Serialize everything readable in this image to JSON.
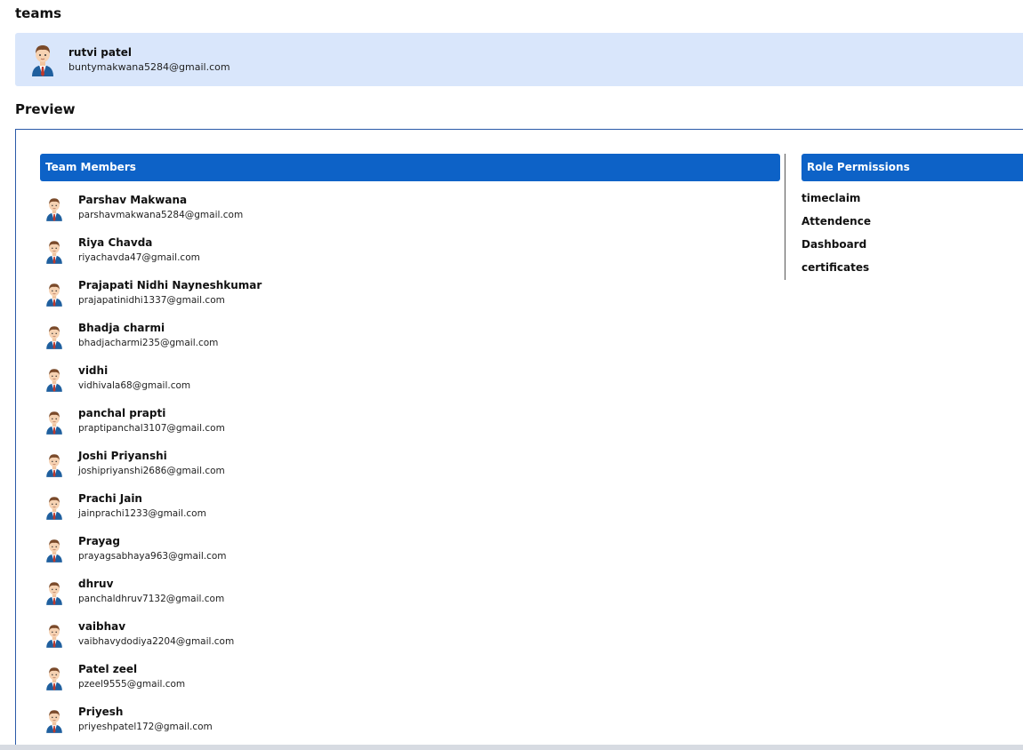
{
  "teams_title": "teams",
  "owner": {
    "name": "rutvi patel",
    "email": "buntymakwana5284@gmail.com"
  },
  "preview_title": "Preview",
  "members_header": "Team Members",
  "permissions_header": "Role Permissions",
  "members": [
    {
      "name": "Parshav Makwana",
      "email": "parshavmakwana5284@gmail.com"
    },
    {
      "name": "Riya Chavda",
      "email": "riyachavda47@gmail.com"
    },
    {
      "name": "Prajapati Nidhi Nayneshkumar",
      "email": "prajapatinidhi1337@gmail.com"
    },
    {
      "name": "Bhadja charmi",
      "email": "bhadjacharmi235@gmail.com"
    },
    {
      "name": "vidhi",
      "email": "vidhivala68@gmail.com"
    },
    {
      "name": "panchal prapti",
      "email": "praptipanchal3107@gmail.com"
    },
    {
      "name": "Joshi Priyanshi",
      "email": "joshipriyanshi2686@gmail.com"
    },
    {
      "name": "Prachi Jain",
      "email": "jainprachi1233@gmail.com"
    },
    {
      "name": "Prayag",
      "email": "prayagsabhaya963@gmail.com"
    },
    {
      "name": "dhruv",
      "email": "panchaldhruv7132@gmail.com"
    },
    {
      "name": "vaibhav",
      "email": "vaibhavydodiya2204@gmail.com"
    },
    {
      "name": "Patel zeel",
      "email": "pzeel9555@gmail.com"
    },
    {
      "name": "Priyesh",
      "email": "priyeshpatel172@gmail.com"
    }
  ],
  "permissions": [
    "timeclaim",
    "Attendence",
    "Dashboard",
    "certificates"
  ],
  "colors": {
    "accent": "#0d62c7",
    "owner_card_bg": "#d9e6fb",
    "frame_border": "#2a5aa8"
  },
  "icons": {
    "member_avatar": "user-avatar-icon"
  }
}
